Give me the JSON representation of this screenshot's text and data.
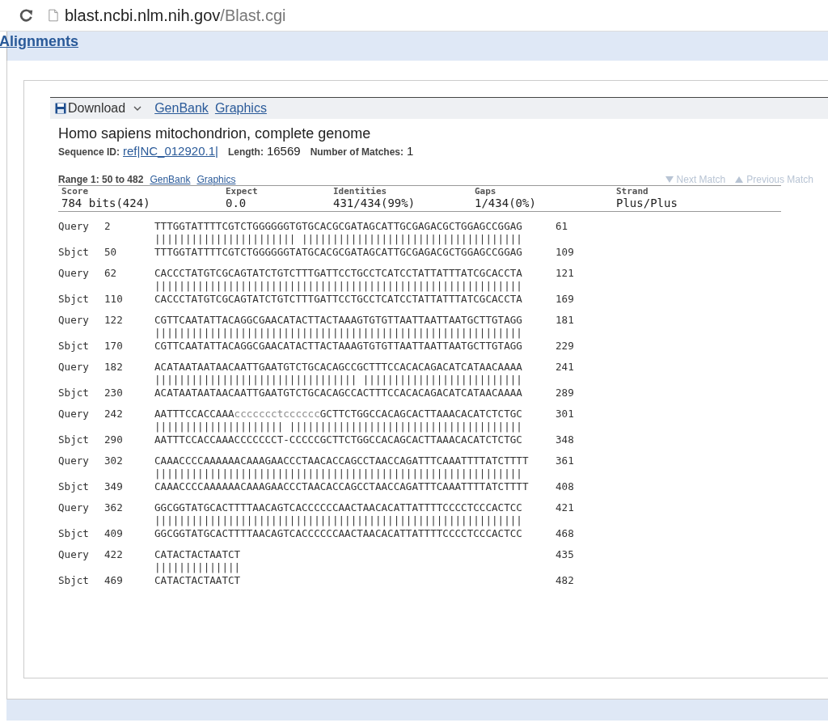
{
  "browser": {
    "url_host": "blast.ncbi.nlm.nih.gov",
    "url_path": "/Blast.cgi"
  },
  "section_title": "Alignments",
  "toolbar": {
    "download": "Download",
    "links": [
      "GenBank",
      "Graphics"
    ]
  },
  "hit": {
    "title": "Homo sapiens mitochondrion, complete genome",
    "sequence_id_label": "Sequence ID:",
    "sequence_id": "ref|NC_012920.1|",
    "length_label": "Length:",
    "length": "16569",
    "matches_label": "Number of Matches:",
    "matches": "1"
  },
  "range": {
    "label": "Range 1: 50 to 482",
    "links": [
      "GenBank",
      "Graphics"
    ],
    "next": "Next Match",
    "previous": "Previous Match"
  },
  "stats": [
    {
      "heading": "Score",
      "value": "784 bits(424)"
    },
    {
      "heading": "Expect",
      "value": "0.0"
    },
    {
      "heading": "Identities",
      "value": "431/434(99%)"
    },
    {
      "heading": "Gaps",
      "value": "1/434(0%)"
    },
    {
      "heading": "Strand",
      "value": "Plus/Plus"
    }
  ],
  "blocks": [
    {
      "query_label": "Query",
      "query_start": "2",
      "query": [
        {
          "text": "TTTGGTATTTTCGTCTGGGGGGTGTGCACGCGATAGCATTGCGAGACGCTGGAGCCGGAG",
          "masked": false
        }
      ],
      "query_end": "61",
      "match": "||||||||||||||||||||||| ||||||||||||||||||||||||||||||||||||",
      "sbjct_label": "Sbjct",
      "sbjct_start": "50",
      "sbjct": "TTTGGTATTTTCGTCTGGGGGGTATGCACGCGATAGCATTGCGAGACGCTGGAGCCGGAG",
      "sbjct_end": "109"
    },
    {
      "query_label": "Query",
      "query_start": "62",
      "query": [
        {
          "text": "CACCCTATGTCGCAGTATCTGTCTTTGATTCCTGCCTCATCCTATTATTTATCGCACCTA",
          "masked": false
        }
      ],
      "query_end": "121",
      "match": "||||||||||||||||||||||||||||||||||||||||||||||||||||||||||||",
      "sbjct_label": "Sbjct",
      "sbjct_start": "110",
      "sbjct": "CACCCTATGTCGCAGTATCTGTCTTTGATTCCTGCCTCATCCTATTATTTATCGCACCTA",
      "sbjct_end": "169"
    },
    {
      "query_label": "Query",
      "query_start": "122",
      "query": [
        {
          "text": "CGTTCAATATTACAGGCGAACATACTTACTAAAGTGTGTTAATTAATTAATGCTTGTAGG",
          "masked": false
        }
      ],
      "query_end": "181",
      "match": "||||||||||||||||||||||||||||||||||||||||||||||||||||||||||||",
      "sbjct_label": "Sbjct",
      "sbjct_start": "170",
      "sbjct": "CGTTCAATATTACAGGCGAACATACTTACTAAAGTGTGTTAATTAATTAATGCTTGTAGG",
      "sbjct_end": "229"
    },
    {
      "query_label": "Query",
      "query_start": "182",
      "query": [
        {
          "text": "ACATAATAATAACAATTGAATGTCTGCACAGCCGCTTTCCACACAGACATCATAACAAAA",
          "masked": false
        }
      ],
      "query_end": "241",
      "match": "||||||||||||||||||||||||||||||||| ||||||||||||||||||||||||||",
      "sbjct_label": "Sbjct",
      "sbjct_start": "230",
      "sbjct": "ACATAATAATAACAATTGAATGTCTGCACAGCCACTTTCCACACAGACATCATAACAAAA",
      "sbjct_end": "289"
    },
    {
      "query_label": "Query",
      "query_start": "242",
      "query": [
        {
          "text": "AATTTCCACCAAA",
          "masked": false
        },
        {
          "text": "ccccccctcccccc",
          "masked": true
        },
        {
          "text": "GCTTCTGGCCACAGCACTTAAACACATCTCTGC",
          "masked": false
        }
      ],
      "query_end": "301",
      "match": "||||||||||||||||||||| ||||||||||||||||||||||||||||||||||||||",
      "sbjct_label": "Sbjct",
      "sbjct_start": "290",
      "sbjct": "AATTTCCACCAAACCCCCCCT-CCCCCGCTTCTGGCCACAGCACTTAAACACATCTCTGC",
      "sbjct_end": "348"
    },
    {
      "query_label": "Query",
      "query_start": "302",
      "query": [
        {
          "text": "CAAACCCCAAAAAACAAAGAACCCTAACACCAGCCTAACCAGATTTCAAATTTTATCTTTT",
          "masked": false
        }
      ],
      "query_end": "361",
      "match": "||||||||||||||||||||||||||||||||||||||||||||||||||||||||||||",
      "sbjct_label": "Sbjct",
      "sbjct_start": "349",
      "sbjct": "CAAACCCCAAAAAACAAAGAACCCTAACACCAGCCTAACCAGATTTCAAATTTTATCTTTT",
      "sbjct_end": "408"
    },
    {
      "query_label": "Query",
      "query_start": "362",
      "query": [
        {
          "text": "GGCGGTATGCACTTTTAACAGTCACCCCCCAACTAACACATTATTTTCCCCTCCCACTCC",
          "masked": false
        }
      ],
      "query_end": "421",
      "match": "||||||||||||||||||||||||||||||||||||||||||||||||||||||||||||",
      "sbjct_label": "Sbjct",
      "sbjct_start": "409",
      "sbjct": "GGCGGTATGCACTTTTAACAGTCACCCCCCAACTAACACATTATTTTCCCCTCCCACTCC",
      "sbjct_end": "468"
    },
    {
      "query_label": "Query",
      "query_start": "422",
      "query": [
        {
          "text": "CATACTACTAATCT",
          "masked": false
        }
      ],
      "query_end": "435",
      "match": "||||||||||||||",
      "sbjct_label": "Sbjct",
      "sbjct_start": "469",
      "sbjct": "CATACTACTAATCT",
      "sbjct_end": "482"
    }
  ]
}
